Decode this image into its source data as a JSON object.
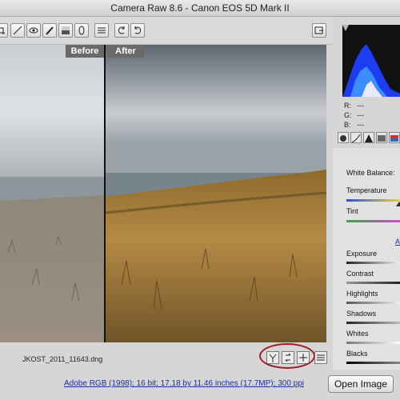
{
  "window": {
    "title": "Camera Raw 8.6  -  Canon EOS 5D Mark II"
  },
  "toolbar": {
    "tool_icons": [
      "crop-icon",
      "straighten-icon",
      "spot-removal-icon",
      "red-eye-icon",
      "adjustment-brush-icon",
      "graduated-filter-icon",
      "radial-filter-icon",
      "preferences-icon",
      "rotate-left-icon",
      "rotate-right-icon",
      "toggle-fullscreen-icon"
    ]
  },
  "preview": {
    "before_label": "Before",
    "after_label": "After"
  },
  "status": {
    "filename": "JKOST_2011_11643.dng"
  },
  "bottom": {
    "workflow_link": "Adobe RGB (1998); 16 bit; 17.18 by 11.46 inches (17.7MP); 300 ppi",
    "open_button": "Open Image"
  },
  "histogram": {
    "r_label": "R:",
    "g_label": "G:",
    "b_label": "B:",
    "value_placeholder": "---"
  },
  "basic_panel": {
    "white_balance_label": "White Balance:",
    "temperature_label": "Temperature",
    "tint_label": "Tint",
    "auto_link": "A",
    "exposure_label": "Exposure",
    "contrast_label": "Contrast",
    "highlights_label": "Highlights",
    "shadows_label": "Shadows",
    "whites_label": "Whites",
    "blacks_label": "Blacks"
  },
  "colors": {
    "accent_circle": "#a01c2a",
    "link": "#1a2fa8"
  }
}
